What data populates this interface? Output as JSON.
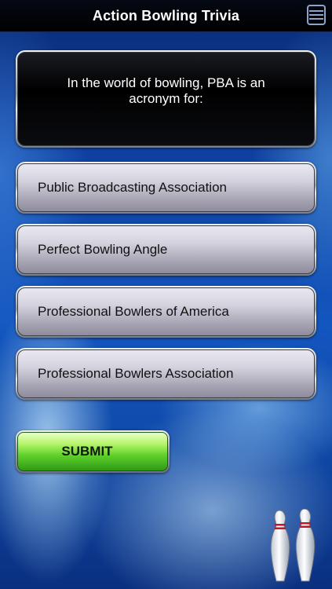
{
  "header": {
    "title": "Action Bowling Trivia",
    "menu_icon": "menu-icon"
  },
  "question": {
    "text": "In the world of bowling, PBA is an acronym for:"
  },
  "answers": [
    {
      "label": "Public Broadcasting Association"
    },
    {
      "label": "Perfect Bowling Angle"
    },
    {
      "label": "Professional Bowlers of America"
    },
    {
      "label": "Professional Bowlers Association"
    }
  ],
  "submit": {
    "label": "SUBMIT"
  },
  "decoration": {
    "icon": "bowling-pins-icon"
  },
  "colors": {
    "header_bg": "#000000",
    "question_bg": "#000000",
    "answer_bg": "#cfcdd8",
    "submit_green": "#5fd02b",
    "background_blue": "#1356bf"
  }
}
